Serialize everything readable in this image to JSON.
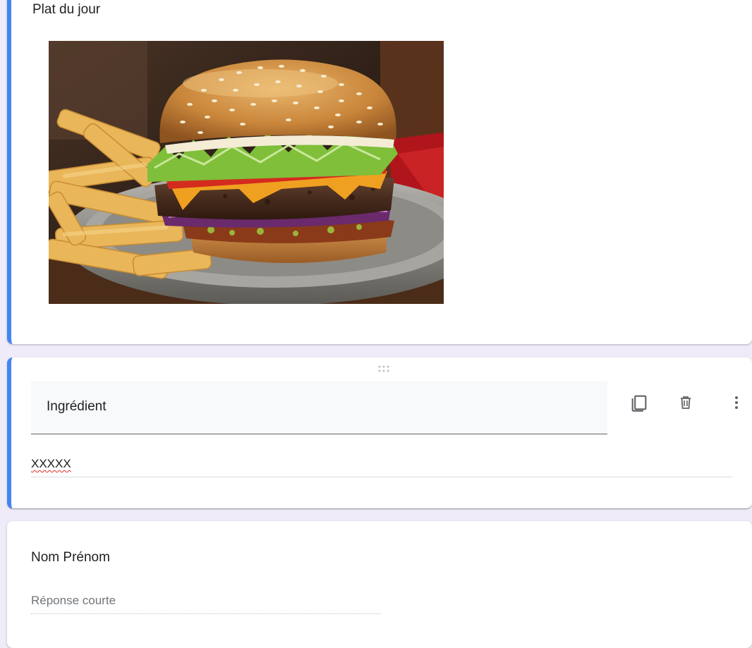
{
  "image_item": {
    "title": "Plat du jour",
    "image_subject": "burger-with-fries-image"
  },
  "active_question": {
    "title": "Ingrédient",
    "answer_value": "XXXXX",
    "icons": {
      "drag": "drag-handle-icon",
      "duplicate": "copy-icon",
      "delete": "trash-icon",
      "more": "more-vert-icon"
    }
  },
  "short_question": {
    "title": "Nom Prénom",
    "placeholder": "Réponse courte"
  },
  "colors": {
    "accent": "#4285f4",
    "background": "#f0ebf8",
    "card": "#ffffff",
    "field_bg": "#f8f9fa",
    "icon": "#5f6368",
    "spell_error": "#d93025"
  }
}
